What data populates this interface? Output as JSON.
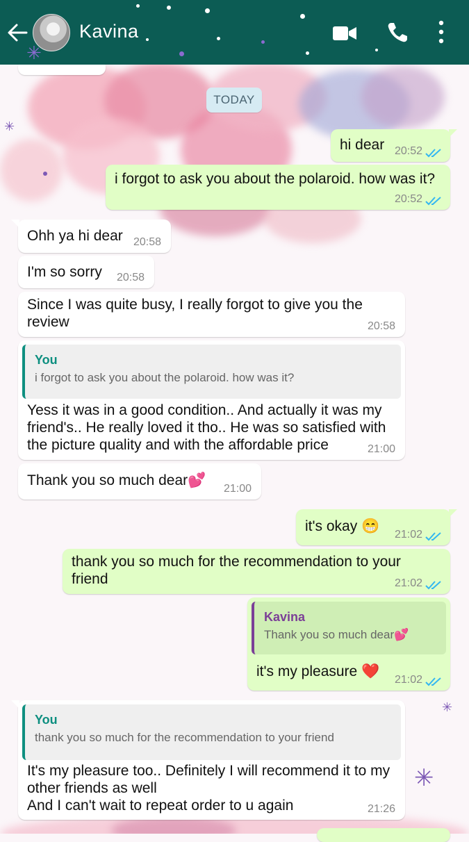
{
  "header": {
    "contact_name": "Kavina",
    "back_icon": "arrow-left-icon",
    "video_icon": "video-call-icon",
    "call_icon": "phone-icon",
    "menu_icon": "more-vert-icon",
    "color": "#0c5c54"
  },
  "date_chip": "TODAY",
  "messages": [
    {
      "dir": "out",
      "text": "hi dear",
      "time": "20:52",
      "status": "read"
    },
    {
      "dir": "out",
      "text": "i forgot to ask you about the polaroid. how was it?",
      "time": "20:52",
      "status": "read"
    },
    {
      "dir": "in",
      "text": "Ohh ya hi dear",
      "time": "20:58"
    },
    {
      "dir": "in",
      "text": "I'm so sorry",
      "time": "20:58"
    },
    {
      "dir": "in",
      "text": "Since I was quite busy, I really forgot to give you the review",
      "time": "20:58"
    },
    {
      "dir": "in",
      "quote_author": "You",
      "quote_text": "i forgot to ask you about the polaroid. how was it?",
      "text": "Yess it was in a good condition.. And actually it was my friend's.. He really loved it tho.. He was so satisfied with the picture quality and with the affordable price",
      "time": "21:00"
    },
    {
      "dir": "in",
      "text": "Thank you so much dear💕",
      "time": "21:00"
    },
    {
      "dir": "out",
      "text": "it's okay 😁",
      "time": "21:02",
      "status": "read"
    },
    {
      "dir": "out",
      "text": "thank you so much for the recommendation to your friend",
      "time": "21:02",
      "status": "read"
    },
    {
      "dir": "out",
      "quote_author": "Kavina",
      "quote_text": "Thank you so much dear💕",
      "text": "it's my pleasure ❤️",
      "time": "21:02",
      "status": "read"
    },
    {
      "dir": "in",
      "quote_author": "You",
      "quote_text": "thank you so much for the recommendation to your friend",
      "text": "It's my pleasure too.. Definitely I will recommend it to my other friends as well\nAnd I can't wait to repeat order to u again",
      "time": "21:26"
    }
  ],
  "colors": {
    "outgoing_bubble": "#e1fec6",
    "incoming_bubble": "#ffffff",
    "read_ticks": "#34b7f1",
    "quote_bar_in": "#0e8f80",
    "quote_bar_out": "#7b3f97"
  }
}
